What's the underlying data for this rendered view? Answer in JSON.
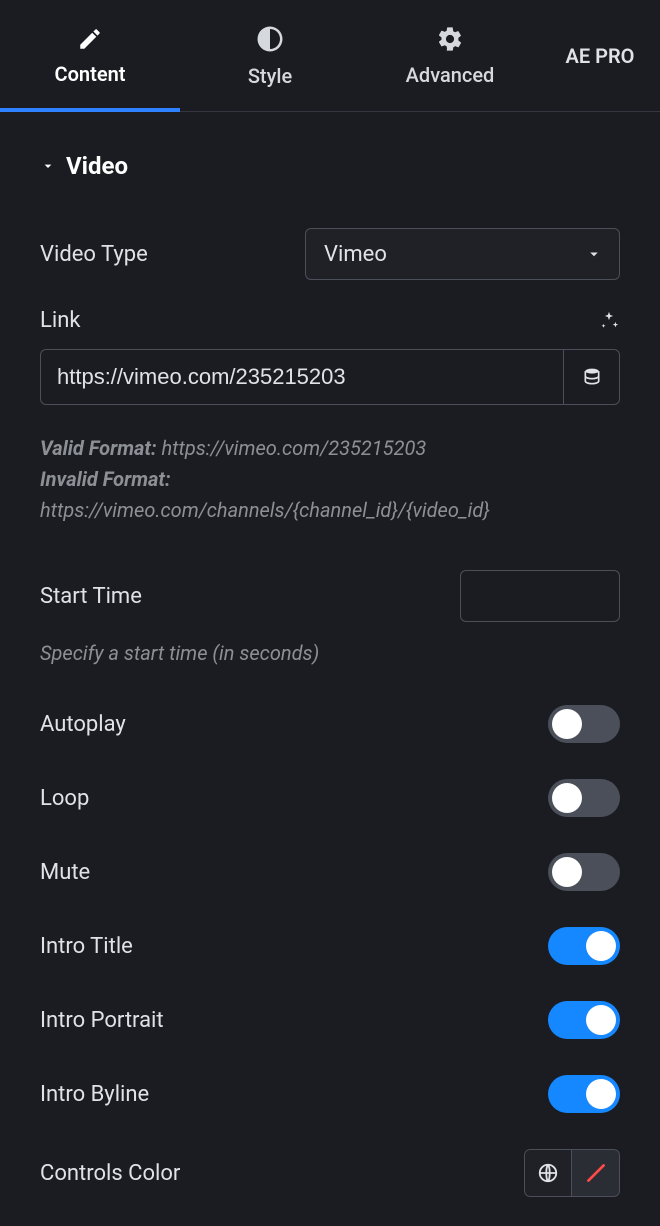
{
  "tabs": {
    "content": "Content",
    "style": "Style",
    "advanced": "Advanced",
    "pro": "AE PRO"
  },
  "section": {
    "title": "Video"
  },
  "video_type": {
    "label": "Video Type",
    "value": "Vimeo"
  },
  "link": {
    "label": "Link",
    "value": "https://vimeo.com/235215203",
    "hint_valid_label": "Valid Format:",
    "hint_valid_value": "https://vimeo.com/235215203",
    "hint_invalid_label": "Invalid Format:",
    "hint_invalid_value": "https://vimeo.com/channels/{channel_id}/{video_id}"
  },
  "start_time": {
    "label": "Start Time",
    "value": "",
    "hint": "Specify a start time (in seconds)"
  },
  "toggles": {
    "autoplay": {
      "label": "Autoplay",
      "on": false
    },
    "loop": {
      "label": "Loop",
      "on": false
    },
    "mute": {
      "label": "Mute",
      "on": false
    },
    "intro_title": {
      "label": "Intro Title",
      "on": true
    },
    "intro_portrait": {
      "label": "Intro Portrait",
      "on": true
    },
    "intro_byline": {
      "label": "Intro Byline",
      "on": true
    }
  },
  "controls_color": {
    "label": "Controls Color"
  }
}
